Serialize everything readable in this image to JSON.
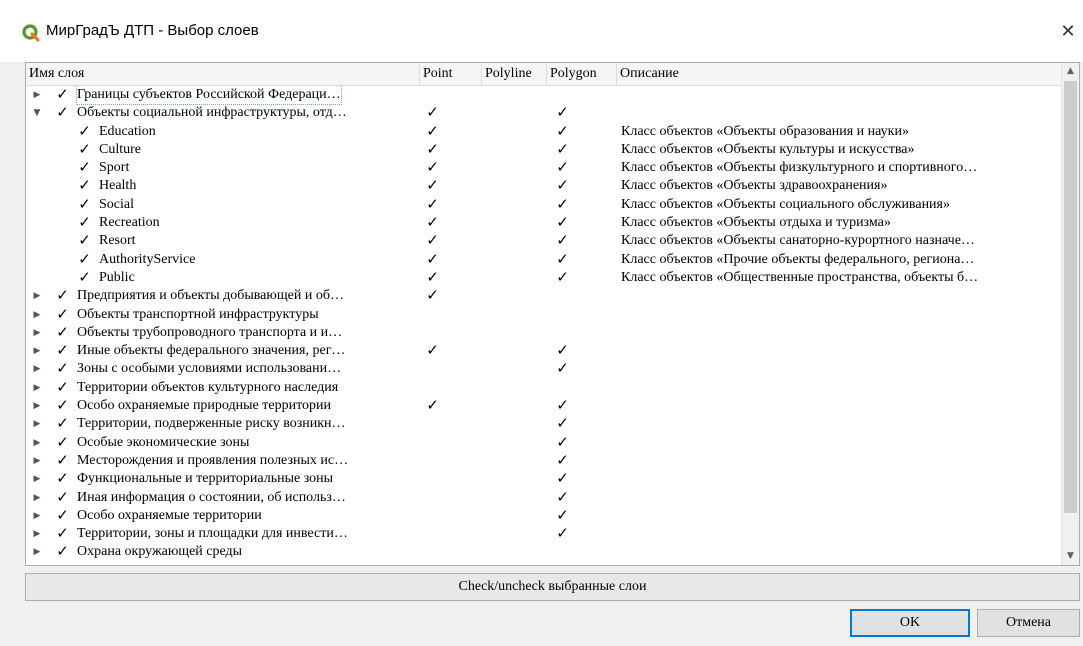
{
  "window": {
    "title": "МирГрадЪ ДТП - Выбор слоев",
    "close_glyph": "✕",
    "icon": "qgis-icon",
    "accent_color": "#589632"
  },
  "table": {
    "columns": [
      "Имя слоя",
      "Point",
      "Polyline",
      "Polygon",
      "Описание"
    ],
    "rows": [
      {
        "level": 0,
        "expand": "collapsed",
        "checked": true,
        "name": "Границы субъектов Российской Федераци…",
        "point": false,
        "polyline": false,
        "polygon": false,
        "desc": "",
        "selected": true
      },
      {
        "level": 0,
        "expand": "expanded",
        "checked": true,
        "name": "Объекты социальной инфраструктуры, отд…",
        "point": true,
        "polyline": false,
        "polygon": true,
        "desc": ""
      },
      {
        "level": 1,
        "expand": "none",
        "checked": true,
        "name": "Education",
        "point": true,
        "polyline": false,
        "polygon": true,
        "desc": "Класс объектов «Объекты образования и науки»"
      },
      {
        "level": 1,
        "expand": "none",
        "checked": true,
        "name": "Culture",
        "point": true,
        "polyline": false,
        "polygon": true,
        "desc": "Класс объектов «Объекты культуры и искусства»"
      },
      {
        "level": 1,
        "expand": "none",
        "checked": true,
        "name": "Sport",
        "point": true,
        "polyline": false,
        "polygon": true,
        "desc": "Класс объектов «Объекты физкультурного и спортивного…"
      },
      {
        "level": 1,
        "expand": "none",
        "checked": true,
        "name": "Health",
        "point": true,
        "polyline": false,
        "polygon": true,
        "desc": "Класс объектов «Объекты здравоохранения»"
      },
      {
        "level": 1,
        "expand": "none",
        "checked": true,
        "name": "Social",
        "point": true,
        "polyline": false,
        "polygon": true,
        "desc": "Класс объектов «Объекты социального обслуживания»"
      },
      {
        "level": 1,
        "expand": "none",
        "checked": true,
        "name": "Recreation",
        "point": true,
        "polyline": false,
        "polygon": true,
        "desc": "Класс объектов «Объекты отдыха и туризма»"
      },
      {
        "level": 1,
        "expand": "none",
        "checked": true,
        "name": "Resort",
        "point": true,
        "polyline": false,
        "polygon": true,
        "desc": "Класс объектов «Объекты санаторно-курортного назначе…"
      },
      {
        "level": 1,
        "expand": "none",
        "checked": true,
        "name": "AuthorityService",
        "point": true,
        "polyline": false,
        "polygon": true,
        "desc": "Класс объектов «Прочие объекты федерального, региона…"
      },
      {
        "level": 1,
        "expand": "none",
        "checked": true,
        "name": "Public",
        "point": true,
        "polyline": false,
        "polygon": true,
        "desc": "Класс объектов «Общественные пространства, объекты б…"
      },
      {
        "level": 0,
        "expand": "collapsed",
        "checked": true,
        "name": "Предприятия и объекты добывающей и об…",
        "point": true,
        "polyline": false,
        "polygon": false,
        "desc": ""
      },
      {
        "level": 0,
        "expand": "collapsed",
        "checked": true,
        "name": "Объекты транспортной инфраструктуры",
        "point": false,
        "polyline": false,
        "polygon": false,
        "desc": ""
      },
      {
        "level": 0,
        "expand": "collapsed",
        "checked": true,
        "name": "Объекты трубопроводного транспорта и и…",
        "point": false,
        "polyline": false,
        "polygon": false,
        "desc": ""
      },
      {
        "level": 0,
        "expand": "collapsed",
        "checked": true,
        "name": "Иные объекты федерального значения, рег…",
        "point": true,
        "polyline": false,
        "polygon": true,
        "desc": ""
      },
      {
        "level": 0,
        "expand": "collapsed",
        "checked": true,
        "name": "Зоны с особыми условиями использовани…",
        "point": false,
        "polyline": false,
        "polygon": true,
        "desc": ""
      },
      {
        "level": 0,
        "expand": "collapsed",
        "checked": true,
        "name": "Территории объектов культурного наследия",
        "point": false,
        "polyline": false,
        "polygon": false,
        "desc": ""
      },
      {
        "level": 0,
        "expand": "collapsed",
        "checked": true,
        "name": "Особо охраняемые природные территории",
        "point": true,
        "polyline": false,
        "polygon": true,
        "desc": ""
      },
      {
        "level": 0,
        "expand": "collapsed",
        "checked": true,
        "name": "Территории, подверженные риску возникн…",
        "point": false,
        "polyline": false,
        "polygon": true,
        "desc": ""
      },
      {
        "level": 0,
        "expand": "collapsed",
        "checked": true,
        "name": "Особые экономические зоны",
        "point": false,
        "polyline": false,
        "polygon": true,
        "desc": ""
      },
      {
        "level": 0,
        "expand": "collapsed",
        "checked": true,
        "name": "Месторождения и проявления полезных ис…",
        "point": false,
        "polyline": false,
        "polygon": true,
        "desc": ""
      },
      {
        "level": 0,
        "expand": "collapsed",
        "checked": true,
        "name": "Функциональные и территориальные зоны",
        "point": false,
        "polyline": false,
        "polygon": true,
        "desc": ""
      },
      {
        "level": 0,
        "expand": "collapsed",
        "checked": true,
        "name": "Иная информация о состоянии, об использ…",
        "point": false,
        "polyline": false,
        "polygon": true,
        "desc": ""
      },
      {
        "level": 0,
        "expand": "collapsed",
        "checked": true,
        "name": "Особо охраняемые территории",
        "point": false,
        "polyline": false,
        "polygon": true,
        "desc": ""
      },
      {
        "level": 0,
        "expand": "collapsed",
        "checked": true,
        "name": "Территории, зоны и площадки для инвести…",
        "point": false,
        "polyline": false,
        "polygon": true,
        "desc": ""
      },
      {
        "level": 0,
        "expand": "collapsed",
        "checked": true,
        "name": "Охрана окружающей среды",
        "point": false,
        "polyline": false,
        "polygon": false,
        "desc": ""
      }
    ]
  },
  "glyphs": {
    "check": "✓",
    "collapsed_arrow": "▶",
    "expanded_arrow": "▼",
    "scroll_up": "▲",
    "scroll_down": "▼"
  },
  "buttons": {
    "check_uncheck": "Check/uncheck выбранные слои",
    "ok": "OK",
    "cancel": "Отмена"
  }
}
